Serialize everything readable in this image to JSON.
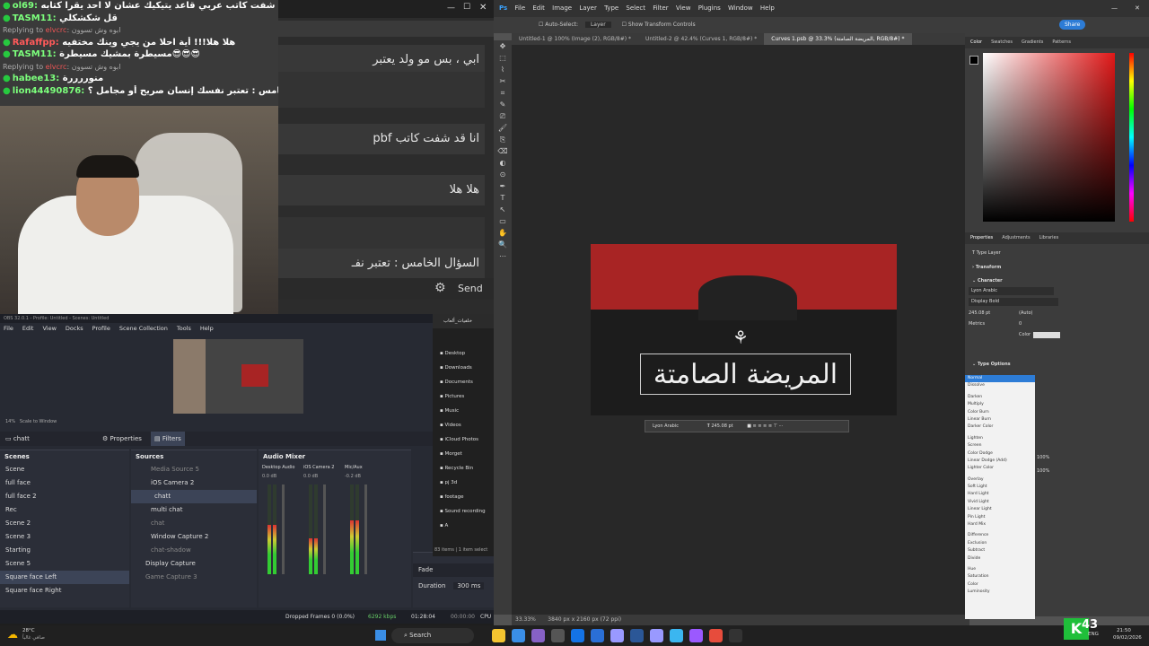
{
  "stream_chat": {
    "lines": [
      {
        "user": "ol69:",
        "text": "انا قد شفت كاتب عربي قاعد يتيكيك عشان لا احد يقرا كتابه pbf"
      },
      {
        "user": "TASM11:",
        "text": "قل شكشكلي"
      },
      {
        "reply_to": "Replying to",
        "reply_user": "elvcrc",
        "reply_text": "ابوه وش تسوون"
      },
      {
        "user": "Rafaffpp:",
        "text": "هلا هلا!!! أية احلا من يجي وينك مختفيه"
      },
      {
        "user": "TASM11:",
        "text": "مسيطرة بمشيك مسيطرة😎😎😎"
      },
      {
        "reply_to": "Replying to",
        "reply_user": "elvcrc",
        "reply_text": "ابوه وش تسوون"
      },
      {
        "user": "habee13:",
        "text": "منوررررة"
      },
      {
        "user": "lion44490876:",
        "text": "السؤال الخامس : تعتبر نفسك إنسان صريح أو مجامل ؟"
      }
    ]
  },
  "big_chat": {
    "bubbles": [
      "ابي ، بس مو ولد يعتبر",
      "انا قد شفت كاتب pbf",
      "هلا هلا",
      "السؤال الخامس : تعتبر نفـ"
    ],
    "send_label": "Send"
  },
  "obs": {
    "title": "OBS 32.0.1 - Profile: Untitled - Scenes: Untitled",
    "menu": [
      "File",
      "Edit",
      "View",
      "Docks",
      "Profile",
      "Scene Collection",
      "Tools",
      "Help"
    ],
    "zoom": "14%",
    "scale_label": "Scale to Window",
    "selected_source": "chatt",
    "properties_label": "Properties",
    "filters_label": "Filters",
    "scenes_title": "Scenes",
    "scenes": [
      "Scene",
      "full face",
      "full face 2",
      "Rec",
      "Scene 2",
      "Scene 3",
      "Starting",
      "Scene 5",
      "Square face Left",
      "Square face Right"
    ],
    "selected_scene": "Square face Left",
    "sources_title": "Sources",
    "sources": [
      "Media Source 5",
      "iOS Camera 2",
      "chatt",
      "multi chat",
      "chat",
      "Window Capture 2",
      "chat-shadow",
      "Display Capture",
      "Game Capture 3"
    ],
    "mixer_title": "Audio Mixer",
    "mixer_channels": [
      {
        "name": "Desktop Audio",
        "db": "0.0 dB",
        "level": 0.55
      },
      {
        "name": "iOS Camera 2",
        "db": "0.0 dB",
        "level": 0.4
      },
      {
        "name": "Mic/Aux",
        "db": "-0.2 dB",
        "level": 0.6
      }
    ],
    "transition_label": "Fade",
    "duration_label": "Duration",
    "duration_value": "300 ms",
    "status": {
      "dropped": "Dropped Frames 0 (0.0%)",
      "bitrate": "6292 kbps",
      "live": "01:28:04",
      "rec": "00:00:00",
      "cpu": "CPU"
    },
    "files_folder": "خلفيات_ألعاب",
    "files_sidebar": [
      "Desktop",
      "Downloads",
      "Documents",
      "Pictures",
      "Music",
      "Videos",
      "iCloud Photos",
      "Morget",
      "Recycle Bin",
      "pj 3d",
      "footage",
      "Sound recording",
      "A"
    ],
    "files_status": "83 items | 1 item select"
  },
  "photoshop": {
    "menu": [
      "File",
      "Edit",
      "Image",
      "Layer",
      "Type",
      "Select",
      "Filter",
      "View",
      "Plugins",
      "Window",
      "Help"
    ],
    "options": [
      "Auto-Select:",
      "Layer",
      "Show Transform Controls"
    ],
    "share_label": "Share",
    "tabs": [
      "Untitled-1 @ 100% (Image (2), RGB/8#) *",
      "Untitled-2 @ 42.4% (Curves 1, RGB/8#) *",
      "Curves 1.psb @ 33.3% (المريضة الصامتة, RGB/8#) *"
    ],
    "active_tab": 2,
    "artwork_text": "المريضة الصامتة",
    "type_bar": {
      "font": "Lyon Arabic",
      "size": "245.08 pt"
    },
    "color_tabs": [
      "Color",
      "Swatches",
      "Gradients",
      "Patterns"
    ],
    "props_tabs": [
      "Properties",
      "Adjustments",
      "Libraries"
    ],
    "props": {
      "type_layer": "Type Layer",
      "transform": "Transform",
      "character": "Character",
      "font": "Lyon Arabic",
      "style": "Display Bold",
      "size": "245.08 pt",
      "leading": "(Auto)",
      "kerning": "Metrics",
      "tracking": "0",
      "color_label": "Color",
      "type_options": "Type Options"
    },
    "blend_modes": [
      [
        "Normal",
        "Dissolve"
      ],
      [
        "Darken",
        "Multiply",
        "Color Burn",
        "Linear Burn",
        "Darker Color"
      ],
      [
        "Lighten",
        "Screen",
        "Color Dodge",
        "Linear Dodge (Add)",
        "Lighter Color"
      ],
      [
        "Overlay",
        "Soft Light",
        "Hard Light",
        "Vivid Light",
        "Linear Light",
        "Pin Light",
        "Hard Mix"
      ],
      [
        "Difference",
        "Exclusion",
        "Subtract",
        "Divide"
      ],
      [
        "Hue",
        "Saturation",
        "Color",
        "Luminosity"
      ]
    ],
    "opacity": "100%",
    "fill": "100%",
    "status_zoom": "33.33%",
    "status_doc": "3840 px x 2160 px (72 ppi)"
  },
  "taskbar": {
    "weather_temp": "28°C",
    "weather_text": "صافي غالباً",
    "search": "Search",
    "lang": "ENG",
    "time": "21:50",
    "date": "09/02/2026",
    "overlay_number": "43"
  },
  "colors": {
    "accent": "#2d7cd6",
    "chat_green": "#27c93f",
    "art_red": "#a82424"
  }
}
